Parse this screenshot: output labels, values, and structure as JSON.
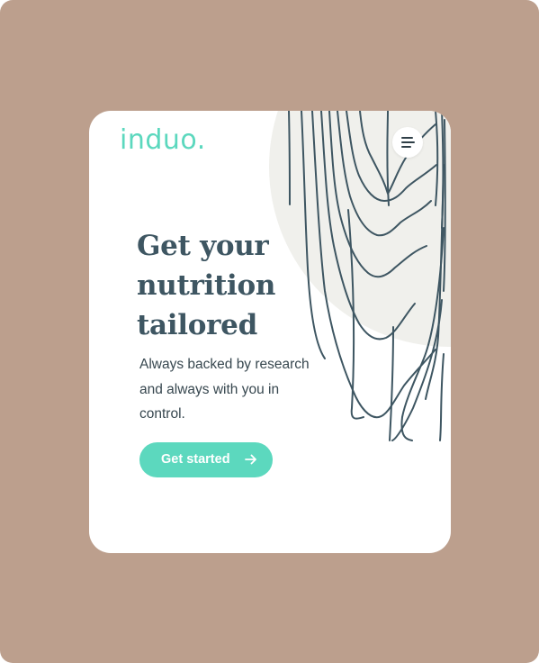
{
  "brand": {
    "logo_text": "induo.",
    "accent_color": "#5cd8be"
  },
  "header": {
    "menu_icon": "hamburger-menu-icon"
  },
  "hero": {
    "headline_line1": "Get your",
    "headline_line2": "nutrition",
    "headline_line3": "tailored",
    "subtext_line1": "Always backed by research",
    "subtext_line2": "and always with you in",
    "subtext_line3": "control.",
    "cta_label": "Get started",
    "cta_icon": "arrow-right-icon"
  },
  "colors": {
    "backdrop": "#bc9f8d",
    "card": "#ffffff",
    "headline": "#3e5662",
    "illustration_stroke": "#3e5662",
    "illustration_circle": "#f0f0ec"
  }
}
